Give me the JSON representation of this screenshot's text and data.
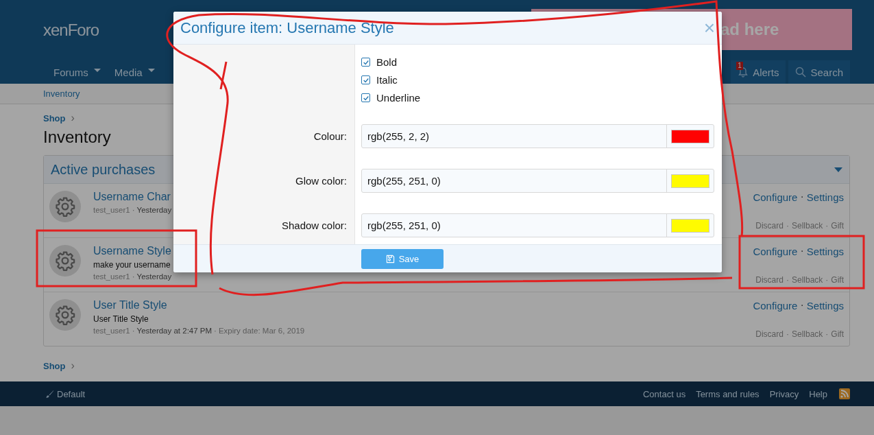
{
  "page": {
    "logo": "xenForo",
    "ad_banner": "ad here",
    "nav": [
      {
        "label": "Forums",
        "dropdown": true
      },
      {
        "label": "Media",
        "dropdown": true
      }
    ],
    "alerts": {
      "label": "Alerts",
      "badge": "1"
    },
    "search": "Search",
    "breadcrumb_bar": "Inventory",
    "breadcrumb": "Shop",
    "chevron": "›",
    "title": "Inventory",
    "block": {
      "title": "Active purchases",
      "separator": "·",
      "items": [
        {
          "title": "Username Char",
          "meta": [
            "test_user1",
            "Yesterday"
          ],
          "actions": [
            "Configure",
            "Settings"
          ],
          "secondary_actions": [
            "Discard",
            "Sellback",
            "Gift"
          ]
        },
        {
          "title": "Username Style",
          "description": "make your username",
          "meta": [
            "test_user1",
            "Yesterday"
          ],
          "actions": [
            "Configure",
            "Settings"
          ],
          "secondary_actions": [
            "Discard",
            "Sellback",
            "Gift"
          ]
        },
        {
          "title": "User Title Style",
          "description": "User Title Style",
          "meta": [
            "test_user1",
            "Yesterday at 2:47 PM",
            "Expiry date: Mar 6, 2019"
          ],
          "actions": [
            "Configure",
            "Settings"
          ],
          "secondary_actions": [
            "Discard",
            "Sellback",
            "Gift"
          ]
        }
      ]
    },
    "bottom_breadcrumb": "Shop"
  },
  "footer": {
    "style": "Default",
    "links": [
      "Contact us",
      "Terms and rules",
      "Privacy",
      "Help"
    ]
  },
  "dialog": {
    "title": "Configure item: Username Style",
    "close": "×",
    "rows": [
      {
        "kind": "checkbox",
        "label": "Bold",
        "checked": true
      },
      {
        "kind": "checkbox",
        "label": "Italic",
        "checked": true
      },
      {
        "kind": "checkbox",
        "label": "Underline",
        "checked": true
      },
      {
        "kind": "color",
        "label": "Colour:",
        "value": "rgb(255, 2, 2)",
        "color": "#ff0202"
      },
      {
        "kind": "color",
        "label": "Glow color:",
        "value": "rgb(255, 251, 0)",
        "color": "#fffb00"
      },
      {
        "kind": "color",
        "label": "Shadow color:",
        "value": "rgb(255, 251, 0)",
        "color": "#fffb00"
      }
    ],
    "save": "Save"
  }
}
